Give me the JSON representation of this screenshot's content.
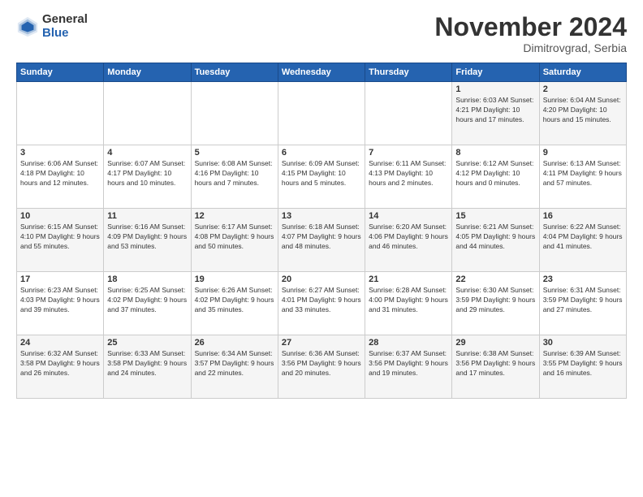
{
  "logo": {
    "general": "General",
    "blue": "Blue"
  },
  "header": {
    "month": "November 2024",
    "location": "Dimitrovgrad, Serbia"
  },
  "days_of_week": [
    "Sunday",
    "Monday",
    "Tuesday",
    "Wednesday",
    "Thursday",
    "Friday",
    "Saturday"
  ],
  "weeks": [
    [
      {
        "num": "",
        "info": ""
      },
      {
        "num": "",
        "info": ""
      },
      {
        "num": "",
        "info": ""
      },
      {
        "num": "",
        "info": ""
      },
      {
        "num": "",
        "info": ""
      },
      {
        "num": "1",
        "info": "Sunrise: 6:03 AM\nSunset: 4:21 PM\nDaylight: 10 hours and 17 minutes."
      },
      {
        "num": "2",
        "info": "Sunrise: 6:04 AM\nSunset: 4:20 PM\nDaylight: 10 hours and 15 minutes."
      }
    ],
    [
      {
        "num": "3",
        "info": "Sunrise: 6:06 AM\nSunset: 4:18 PM\nDaylight: 10 hours and 12 minutes."
      },
      {
        "num": "4",
        "info": "Sunrise: 6:07 AM\nSunset: 4:17 PM\nDaylight: 10 hours and 10 minutes."
      },
      {
        "num": "5",
        "info": "Sunrise: 6:08 AM\nSunset: 4:16 PM\nDaylight: 10 hours and 7 minutes."
      },
      {
        "num": "6",
        "info": "Sunrise: 6:09 AM\nSunset: 4:15 PM\nDaylight: 10 hours and 5 minutes."
      },
      {
        "num": "7",
        "info": "Sunrise: 6:11 AM\nSunset: 4:13 PM\nDaylight: 10 hours and 2 minutes."
      },
      {
        "num": "8",
        "info": "Sunrise: 6:12 AM\nSunset: 4:12 PM\nDaylight: 10 hours and 0 minutes."
      },
      {
        "num": "9",
        "info": "Sunrise: 6:13 AM\nSunset: 4:11 PM\nDaylight: 9 hours and 57 minutes."
      }
    ],
    [
      {
        "num": "10",
        "info": "Sunrise: 6:15 AM\nSunset: 4:10 PM\nDaylight: 9 hours and 55 minutes."
      },
      {
        "num": "11",
        "info": "Sunrise: 6:16 AM\nSunset: 4:09 PM\nDaylight: 9 hours and 53 minutes."
      },
      {
        "num": "12",
        "info": "Sunrise: 6:17 AM\nSunset: 4:08 PM\nDaylight: 9 hours and 50 minutes."
      },
      {
        "num": "13",
        "info": "Sunrise: 6:18 AM\nSunset: 4:07 PM\nDaylight: 9 hours and 48 minutes."
      },
      {
        "num": "14",
        "info": "Sunrise: 6:20 AM\nSunset: 4:06 PM\nDaylight: 9 hours and 46 minutes."
      },
      {
        "num": "15",
        "info": "Sunrise: 6:21 AM\nSunset: 4:05 PM\nDaylight: 9 hours and 44 minutes."
      },
      {
        "num": "16",
        "info": "Sunrise: 6:22 AM\nSunset: 4:04 PM\nDaylight: 9 hours and 41 minutes."
      }
    ],
    [
      {
        "num": "17",
        "info": "Sunrise: 6:23 AM\nSunset: 4:03 PM\nDaylight: 9 hours and 39 minutes."
      },
      {
        "num": "18",
        "info": "Sunrise: 6:25 AM\nSunset: 4:02 PM\nDaylight: 9 hours and 37 minutes."
      },
      {
        "num": "19",
        "info": "Sunrise: 6:26 AM\nSunset: 4:02 PM\nDaylight: 9 hours and 35 minutes."
      },
      {
        "num": "20",
        "info": "Sunrise: 6:27 AM\nSunset: 4:01 PM\nDaylight: 9 hours and 33 minutes."
      },
      {
        "num": "21",
        "info": "Sunrise: 6:28 AM\nSunset: 4:00 PM\nDaylight: 9 hours and 31 minutes."
      },
      {
        "num": "22",
        "info": "Sunrise: 6:30 AM\nSunset: 3:59 PM\nDaylight: 9 hours and 29 minutes."
      },
      {
        "num": "23",
        "info": "Sunrise: 6:31 AM\nSunset: 3:59 PM\nDaylight: 9 hours and 27 minutes."
      }
    ],
    [
      {
        "num": "24",
        "info": "Sunrise: 6:32 AM\nSunset: 3:58 PM\nDaylight: 9 hours and 26 minutes."
      },
      {
        "num": "25",
        "info": "Sunrise: 6:33 AM\nSunset: 3:58 PM\nDaylight: 9 hours and 24 minutes."
      },
      {
        "num": "26",
        "info": "Sunrise: 6:34 AM\nSunset: 3:57 PM\nDaylight: 9 hours and 22 minutes."
      },
      {
        "num": "27",
        "info": "Sunrise: 6:36 AM\nSunset: 3:56 PM\nDaylight: 9 hours and 20 minutes."
      },
      {
        "num": "28",
        "info": "Sunrise: 6:37 AM\nSunset: 3:56 PM\nDaylight: 9 hours and 19 minutes."
      },
      {
        "num": "29",
        "info": "Sunrise: 6:38 AM\nSunset: 3:56 PM\nDaylight: 9 hours and 17 minutes."
      },
      {
        "num": "30",
        "info": "Sunrise: 6:39 AM\nSunset: 3:55 PM\nDaylight: 9 hours and 16 minutes."
      }
    ]
  ]
}
